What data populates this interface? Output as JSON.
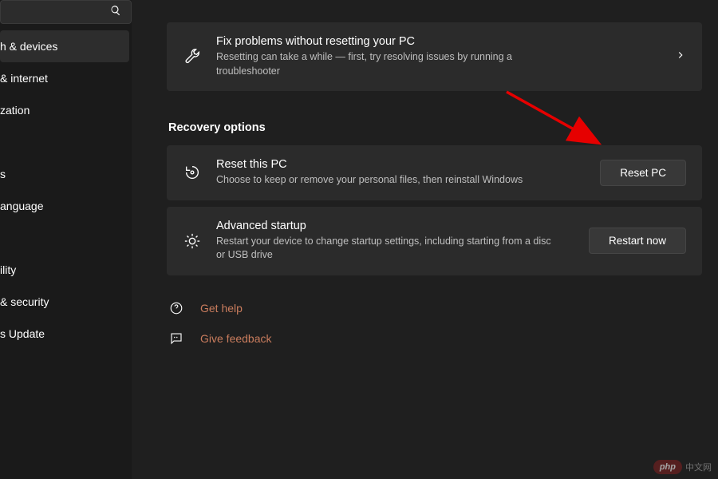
{
  "sidebar": {
    "search_placeholder": "",
    "items": [
      {
        "label": "h & devices",
        "highlight": true
      },
      {
        "label": "& internet",
        "highlight": false
      },
      {
        "label": "zation",
        "highlight": false
      },
      {
        "label": "",
        "highlight": false
      },
      {
        "label": "s",
        "highlight": false
      },
      {
        "label": "anguage",
        "highlight": false
      },
      {
        "label": "",
        "highlight": false
      },
      {
        "label": "ility",
        "highlight": false
      },
      {
        "label": "& security",
        "highlight": false
      },
      {
        "label": "s Update",
        "highlight": false
      }
    ]
  },
  "troubleshoot": {
    "title": "Fix problems without resetting your PC",
    "desc": "Resetting can take a while — first, try resolving issues by running a troubleshooter"
  },
  "section_title": "Recovery options",
  "reset": {
    "title": "Reset this PC",
    "desc": "Choose to keep or remove your personal files, then reinstall Windows",
    "button": "Reset PC"
  },
  "advanced": {
    "title": "Advanced startup",
    "desc": "Restart your device to change startup settings, including starting from a disc or USB drive",
    "button": "Restart now"
  },
  "footer": {
    "help": "Get help",
    "feedback": "Give feedback"
  },
  "watermark": {
    "badge": "php",
    "text": "中文网"
  }
}
